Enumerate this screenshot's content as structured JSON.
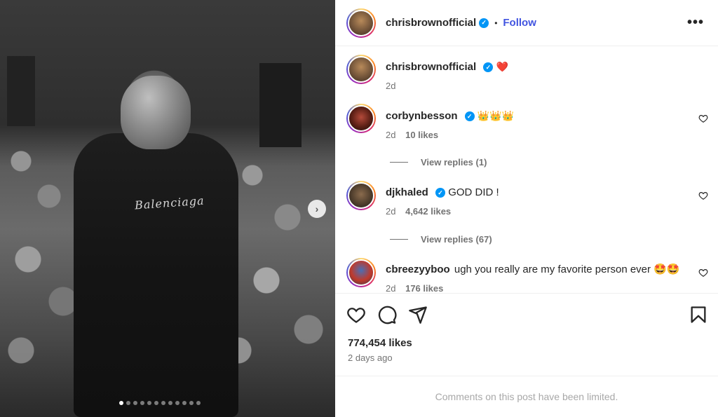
{
  "post": {
    "author": "chrisbrownofficial",
    "follow_label": "Follow",
    "separator": "•",
    "more_label": "•••",
    "caption_emoji": "❤️",
    "caption_time": "2d",
    "media": {
      "brand_text": "Balenciaga",
      "next_label": "›",
      "slide_count": 12,
      "active_slide": 0
    }
  },
  "comments": [
    {
      "user": "corbynbesson",
      "verified": true,
      "text": "👑👑👑",
      "time": "2d",
      "likes": "10 likes",
      "replies": "View replies (1)"
    },
    {
      "user": "djkhaled",
      "verified": true,
      "text": "GOD DID !",
      "time": "2d",
      "likes": "4,642 likes",
      "replies": "View replies (67)"
    },
    {
      "user": "cbreezyyboo",
      "verified": false,
      "text": "ugh you really are my favorite person ever 🤩🤩",
      "time": "2d",
      "likes": "176 likes"
    }
  ],
  "footer": {
    "likes": "774,454 likes",
    "time_ago": "2 days ago",
    "limited_notice": "Comments on this post have been limited."
  },
  "colors": {
    "verified": "#0095f6",
    "follow": "#4154e0",
    "heart": "#ed1c24"
  },
  "icons": {
    "like": "heart-icon",
    "comment": "comment-icon",
    "share": "share-icon",
    "save": "bookmark-icon",
    "more": "more-icon",
    "verified": "verified-badge-icon",
    "next": "chevron-right-icon"
  }
}
